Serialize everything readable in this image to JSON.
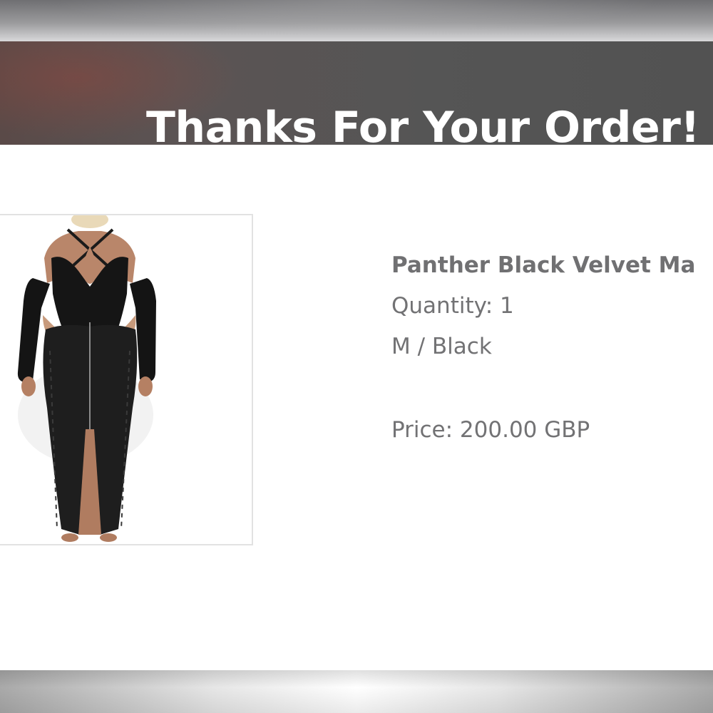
{
  "banner": {
    "title": "Thanks For Your Order!",
    "background_color": "#555555",
    "text_color": "#ffffff"
  },
  "order_item": {
    "image_alt": "black velvet dress product photo",
    "name": "Panther Black Velvet Ma",
    "quantity_text": "Quantity: 1",
    "variant_text": "M / Black",
    "price_text": "Price: 200.00 GBP",
    "text_color": "#707072"
  }
}
